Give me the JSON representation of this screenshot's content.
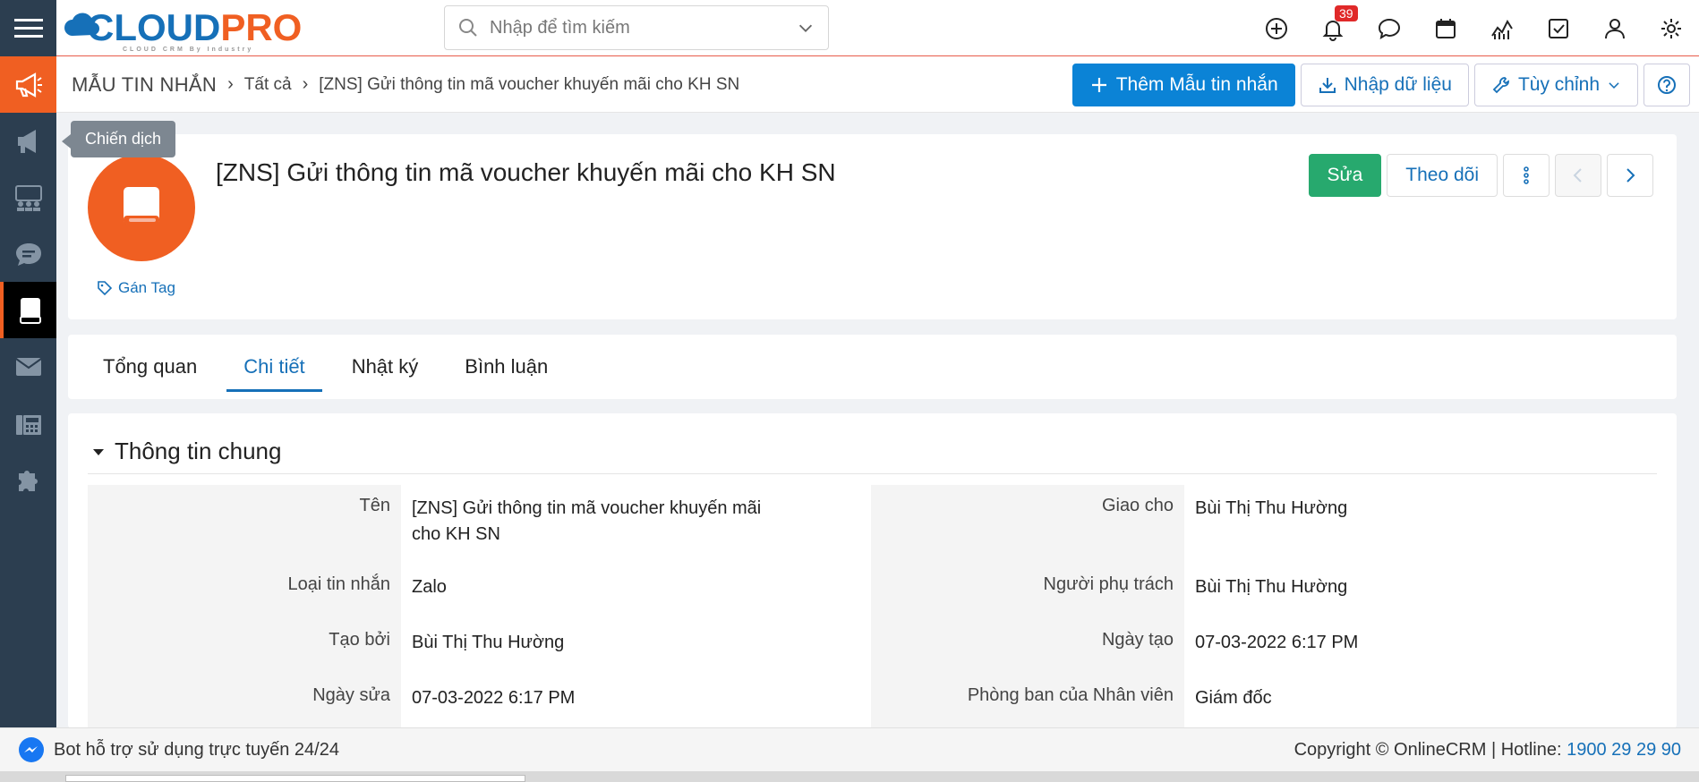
{
  "header": {
    "logo_main": "CLOUD",
    "logo_accent": "PRO",
    "logo_tagline": "CLOUD CRM By Industry",
    "search_placeholder": "Nhập để tìm kiếm",
    "notification_count": "39"
  },
  "breadcrumb": {
    "module": "MẪU TIN NHẮN",
    "filter": "Tất cả",
    "record": "[ZNS] Gửi thông tin mã voucher khuyến mãi cho KH SN"
  },
  "actions": {
    "add_label": "Thêm Mẫu tin nhắn",
    "import_label": "Nhập dữ liệu",
    "customize_label": "Tùy chỉnh"
  },
  "sidebar": {
    "tooltip": "Chiến dịch"
  },
  "record": {
    "title": "[ZNS] Gửi thông tin mã voucher khuyến mãi cho KH SN",
    "tag_label": "Gán Tag",
    "edit_label": "Sửa",
    "follow_label": "Theo dõi"
  },
  "tabs": [
    "Tổng quan",
    "Chi tiết",
    "Nhật ký",
    "Bình luận"
  ],
  "details": {
    "section_title": "Thông tin chung",
    "left": [
      {
        "label": "Tên",
        "value": "[ZNS] Gửi thông tin mã voucher khuyến mãi cho KH SN"
      },
      {
        "label": "Loại tin nhắn",
        "value": "Zalo"
      },
      {
        "label": "Tạo bởi",
        "value": "Bùi Thị Thu Hường"
      },
      {
        "label": "Ngày sửa",
        "value": "07-03-2022 6:17 PM"
      }
    ],
    "right": [
      {
        "label": "Giao cho",
        "value": "Bùi Thị Thu Hường"
      },
      {
        "label": "Người phụ trách",
        "value": "Bùi Thị Thu Hường"
      },
      {
        "label": "Ngày tạo",
        "value": "07-03-2022 6:17 PM"
      },
      {
        "label": "Phòng ban của Nhân viên",
        "value": "Giám đốc"
      }
    ]
  },
  "footer": {
    "bot_text": "Bot hỗ trợ sử dụng trực tuyến 24/24",
    "copyright": "Copyright © OnlineCRM | Hotline: ",
    "hotline": "1900 29 29 90"
  },
  "colors": {
    "brand_blue": "#1670b8",
    "brand_orange": "#f05f22",
    "rail": "#2c3e50",
    "edit_green": "#27a96e"
  }
}
